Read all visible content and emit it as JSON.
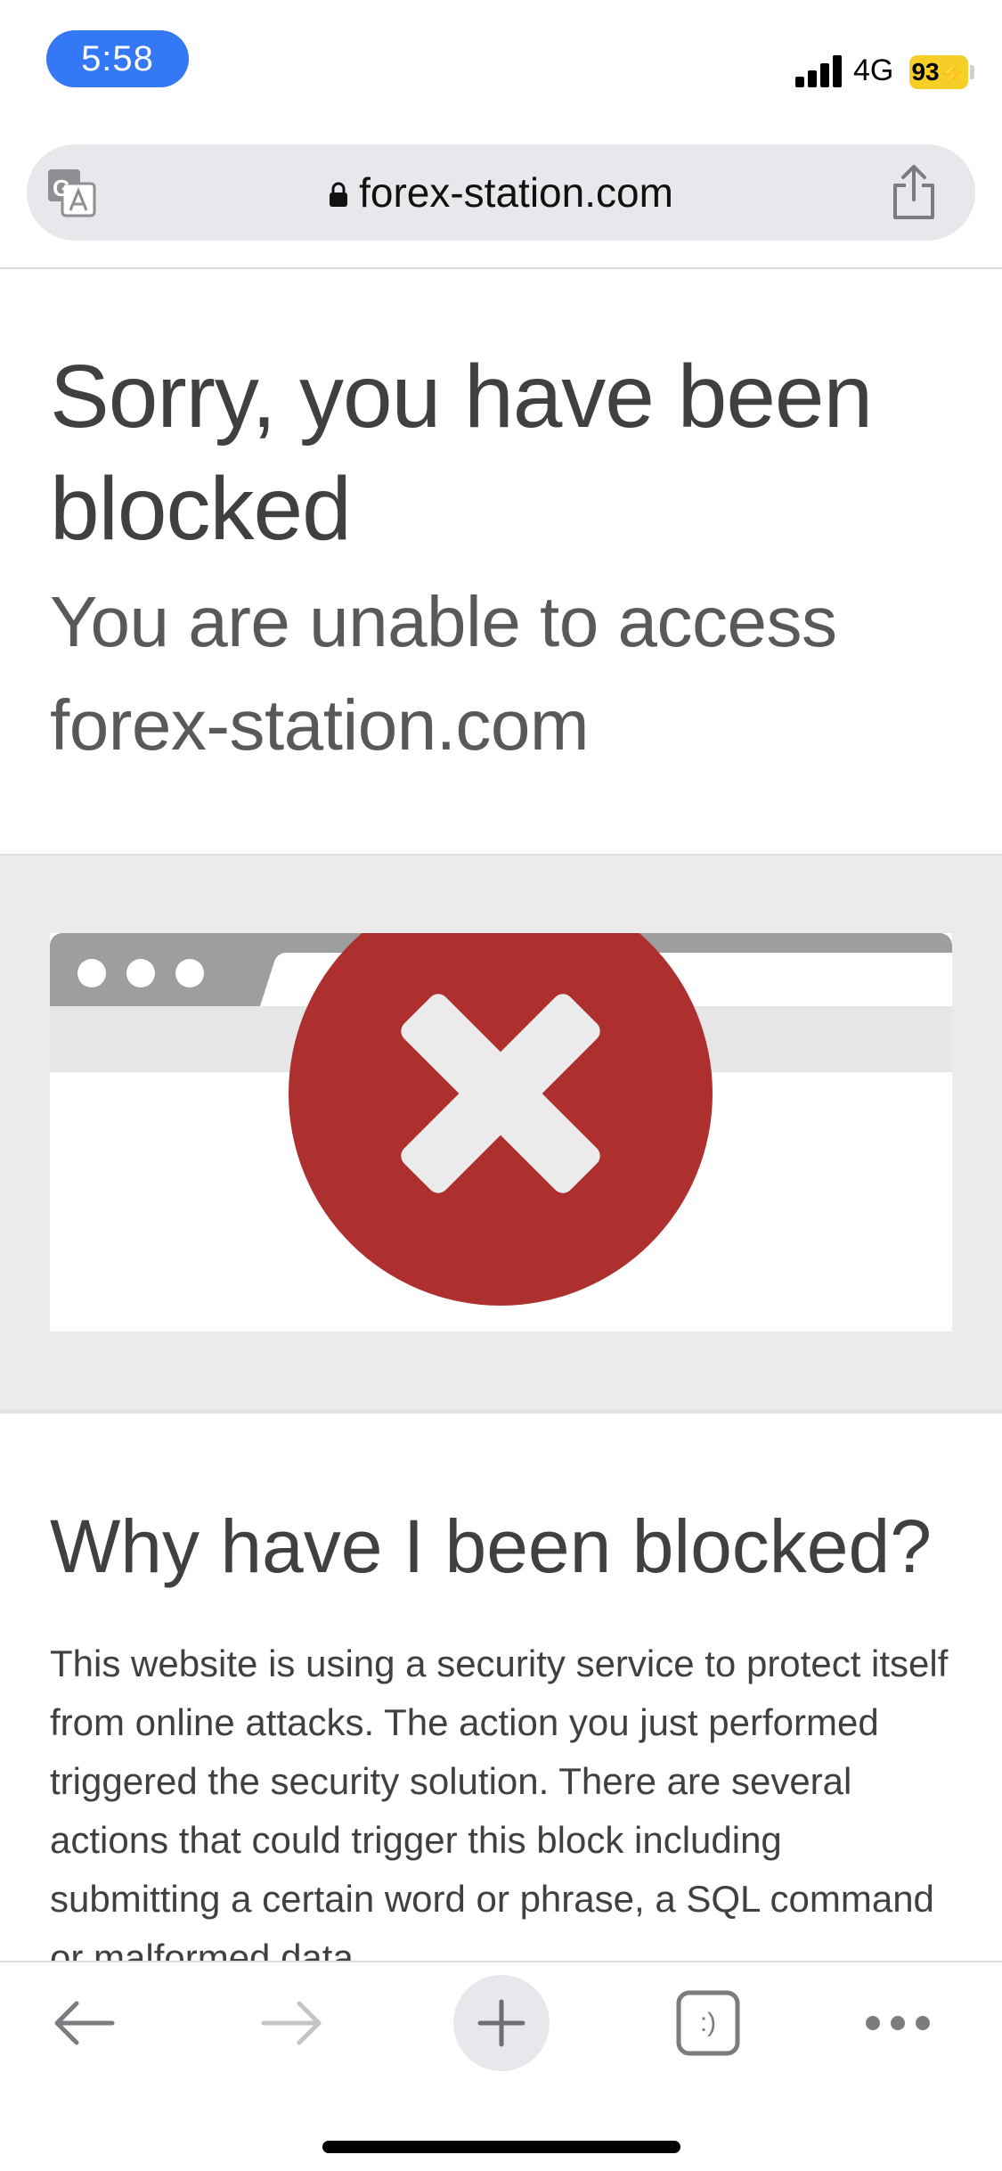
{
  "status_bar": {
    "time": "5:58",
    "network": "4G",
    "battery": "93"
  },
  "address_bar": {
    "url": "forex-station.com"
  },
  "page": {
    "title": "Sorry, you have been blocked",
    "subtitle": "You are unable to access forex-station.com",
    "section_heading": "Why have I been blocked?",
    "section_body": "This website is using a security service to protect itself from online attacks. The action you just performed triggered the security solution. There are several actions that could trigger this block including submitting a certain word or phrase, a SQL command or malformed data."
  },
  "toolbar": {
    "tab_count": ":)"
  },
  "colors": {
    "time_pill": "#3478f6",
    "battery": "#f5cf27",
    "error_circle": "#ad302f",
    "heading_text": "#404040"
  },
  "icons": {
    "translate": "translate-icon",
    "lock": "lock-icon",
    "share": "share-icon",
    "back": "back-arrow-icon",
    "forward": "forward-arrow-icon",
    "new_tab": "plus-icon",
    "tabs": "tabs-icon",
    "more": "more-icon",
    "error": "error-x-icon"
  }
}
